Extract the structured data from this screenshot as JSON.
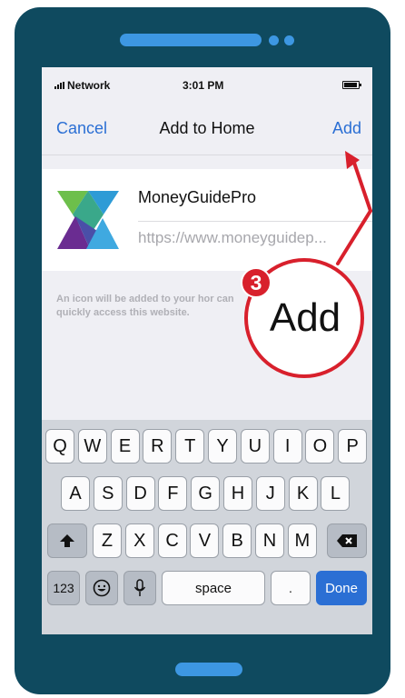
{
  "status_bar": {
    "carrier": "Network",
    "time": "3:01 PM"
  },
  "nav": {
    "cancel_label": "Cancel",
    "title": "Add to Home",
    "add_label": "Add"
  },
  "site": {
    "name": "MoneyGuidePro",
    "url": "https://www.moneyguidep..."
  },
  "info_text": "An icon will be added to your home screen so you can quickly access this website.",
  "info_visible": "An icon will be added to your hor can quickly access this website.",
  "callout": {
    "step": "3",
    "label": "Add"
  },
  "keyboard": {
    "row1": [
      "Q",
      "W",
      "E",
      "R",
      "T",
      "Y",
      "U",
      "I",
      "O",
      "P"
    ],
    "row2": [
      "A",
      "S",
      "D",
      "F",
      "G",
      "H",
      "J",
      "K",
      "L"
    ],
    "row3": [
      "Z",
      "X",
      "C",
      "V",
      "B",
      "N",
      "M"
    ],
    "numbers_label": "123",
    "space_label": "space",
    "period_label": ".",
    "done_label": "Done"
  },
  "colors": {
    "frame": "#0f4a5f",
    "accent": "#3d97e2",
    "ios_blue": "#2b6fd4",
    "callout_red": "#d8202c"
  }
}
